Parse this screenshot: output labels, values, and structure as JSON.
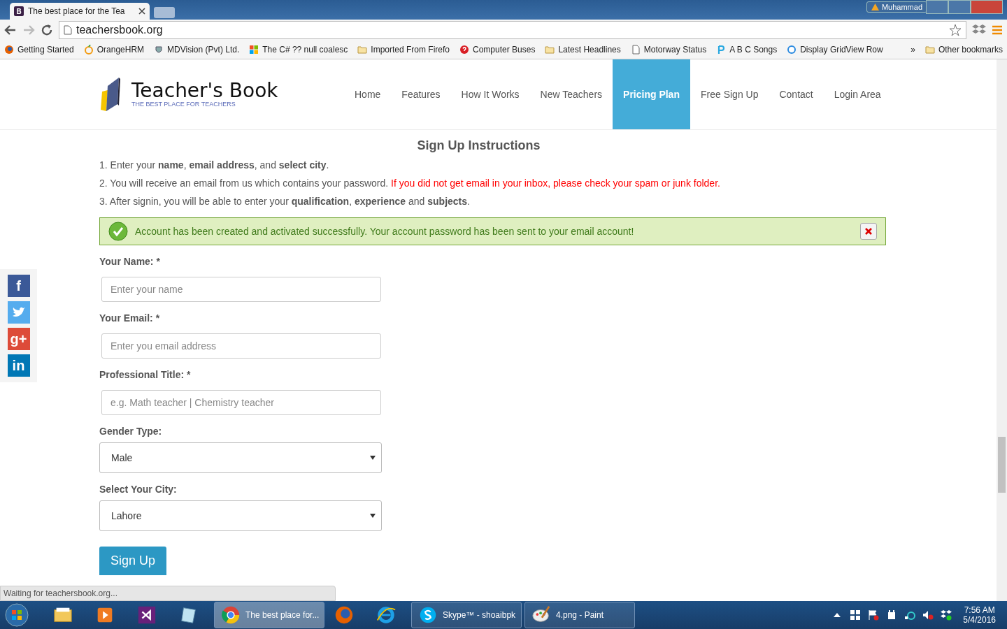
{
  "browser": {
    "tab_title": "The best place for the Tea",
    "tab_favicon": "B",
    "user_name": "Muhammad",
    "url": "teachersbook.org",
    "bookmarks": [
      {
        "kind": "firefox",
        "label": "Getting Started"
      },
      {
        "kind": "orange",
        "label": "OrangeHRM"
      },
      {
        "kind": "shield",
        "label": "MDVision (Pvt) Ltd."
      },
      {
        "kind": "windows",
        "label": "The C# ?? null coalesc"
      },
      {
        "kind": "folder",
        "label": "Imported From Firefo"
      },
      {
        "kind": "help",
        "label": "Computer Buses"
      },
      {
        "kind": "folder",
        "label": "Latest Headlines"
      },
      {
        "kind": "page",
        "label": "Motorway Status"
      },
      {
        "kind": "p",
        "label": "A B C Songs"
      },
      {
        "kind": "asp",
        "label": "Display GridView Row"
      }
    ],
    "overflow": "»",
    "other_bookmarks": "Other bookmarks"
  },
  "site": {
    "logo_title": "Teacher's Book",
    "logo_tagline": "THE BEST PLACE FOR TEACHERS",
    "nav": [
      {
        "label": "Home",
        "selected": false
      },
      {
        "label": "Features",
        "selected": false
      },
      {
        "label": "How It Works",
        "selected": false
      },
      {
        "label": "New Teachers",
        "selected": false
      },
      {
        "label": "Pricing Plan",
        "selected": true
      },
      {
        "label": "Free Sign Up",
        "selected": false
      },
      {
        "label": "Contact",
        "selected": false
      },
      {
        "label": "Login Area",
        "selected": false
      }
    ]
  },
  "social": [
    {
      "kind": "facebook",
      "label": "f"
    },
    {
      "kind": "twitter"
    },
    {
      "kind": "googleplus",
      "label": "g+"
    },
    {
      "kind": "linkedin",
      "label": "in"
    }
  ],
  "instructions": {
    "title": "Sign Up Instructions",
    "steps": [
      {
        "text": "1. Enter your **name**, **email address**, and **select city**."
      },
      {
        "text": "2. You will receive an email from us which contains your password.",
        "note": "If you did not get email in your inbox, please check your spam or junk folder."
      },
      {
        "text": "3. After signin, you will be able to enter your **qualification**, **experience** and **subjects**."
      }
    ]
  },
  "alert": {
    "message": "Account has been created and activated successfully. Your account password has been sent to your email account!"
  },
  "form": [
    {
      "kind": "input",
      "label": "Your Name: *",
      "placeholder": "Enter your name"
    },
    {
      "kind": "input",
      "label": "Your Email: *",
      "placeholder": "Enter you email address"
    },
    {
      "kind": "input",
      "label": "Professional Title: *",
      "placeholder": "e.g. Math teacher | Chemistry teacher"
    },
    {
      "kind": "select",
      "label": "Gender Type:",
      "value": "Male"
    },
    {
      "kind": "select",
      "label": "Select Your City:",
      "value": "Lahore"
    }
  ],
  "submit": "Sign Up",
  "status": "Waiting for teachersbook.org...",
  "taskbar": {
    "items": [
      {
        "kind": "explorer",
        "selected": false
      },
      {
        "kind": "media",
        "selected": false
      },
      {
        "kind": "vs",
        "selected": false
      },
      {
        "kind": "notepad",
        "selected": false
      },
      {
        "kind": "chrome",
        "label": "The best place for...",
        "selected": true
      },
      {
        "kind": "firefox",
        "selected": false
      },
      {
        "kind": "ie",
        "selected": false
      },
      {
        "kind": "skype",
        "label": "Skype™ - shoaibpk",
        "selected": false
      },
      {
        "kind": "paint",
        "label": "4.png - Paint",
        "selected": false
      }
    ],
    "time": "7:56 AM",
    "date": "5/4/2016"
  }
}
